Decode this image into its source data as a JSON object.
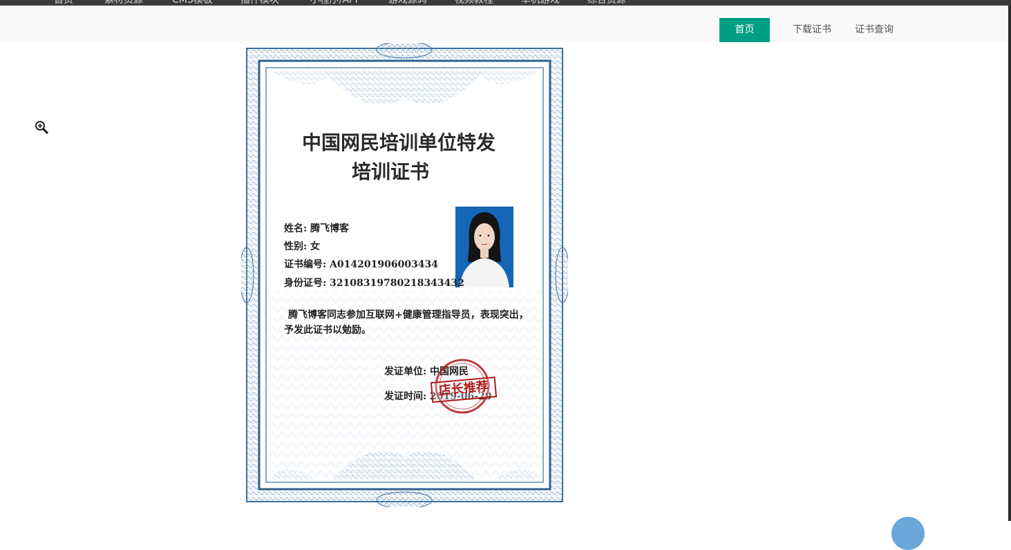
{
  "top_menu": {
    "items": [
      "首页",
      "素材资源",
      "CMS模板",
      "插件模块",
      "小程序/APP",
      "游戏源码",
      "视频教程",
      "单机游戏",
      "综合资源"
    ]
  },
  "nav": {
    "home_label": "首页",
    "download_label": "下载证书",
    "query_label": "证书查询",
    "accent_color": "#009e84"
  },
  "viewer": {
    "zoom_icon": "zoom-in-icon"
  },
  "certificate": {
    "title_line1": "中国网民培训单位特发",
    "title_line2": "培训证书",
    "name_line": "姓名: 腾飞博客",
    "gender_line": "性别: 女",
    "cert_no_line": "证书编号: A014201906003434",
    "id_line": "身份证号: 321083197802183434​32",
    "body_line1": "腾飞博客同志参加互联网+健康管理指导员，表现突出，",
    "body_line2": "予发此证书以勉励。",
    "issuer_line": "发证单位: 中国网民",
    "date_line": "发证时间: 2019-06-29",
    "stamp_label": "店长推荐",
    "frame_color": "#3b6ea0",
    "stamp_color": "#b01818"
  }
}
